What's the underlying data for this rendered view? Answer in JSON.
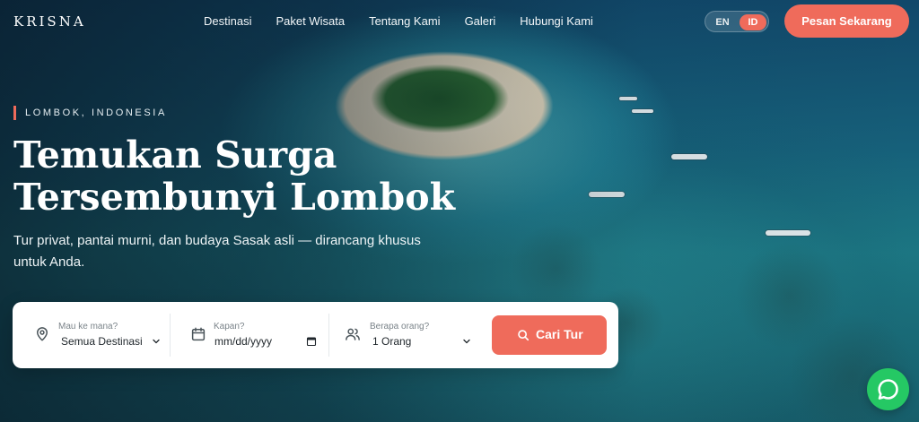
{
  "brand": "KRISNA",
  "nav": {
    "items": [
      "Destinasi",
      "Paket Wisata",
      "Tentang Kami",
      "Galeri",
      "Hubungi Kami"
    ],
    "lang": {
      "en": "EN",
      "id": "ID",
      "active": "ID"
    },
    "cta": "Pesan Sekarang"
  },
  "hero": {
    "eyebrow": "LOMBOK, INDONESIA",
    "title_line1": "Temukan Surga",
    "title_line2": "Tersembunyi Lombok",
    "subtitle": "Tur privat, pantai murni, dan budaya Sasak asli — dirancang khusus untuk Anda."
  },
  "search": {
    "destination": {
      "label": "Mau ke mana?",
      "value": "Semua Destinasi"
    },
    "date": {
      "label": "Kapan?",
      "placeholder": "mm/dd/yyyy"
    },
    "guests": {
      "label": "Berapa orang?",
      "value": "1 Orang"
    },
    "button": "Cari Tur"
  },
  "colors": {
    "accent": "#ef6b5b",
    "whatsapp": "#25c864"
  },
  "icons": [
    "map-pin-icon",
    "calendar-icon",
    "users-icon",
    "chevron-down-icon",
    "search-icon",
    "chat-bubble-icon"
  ]
}
